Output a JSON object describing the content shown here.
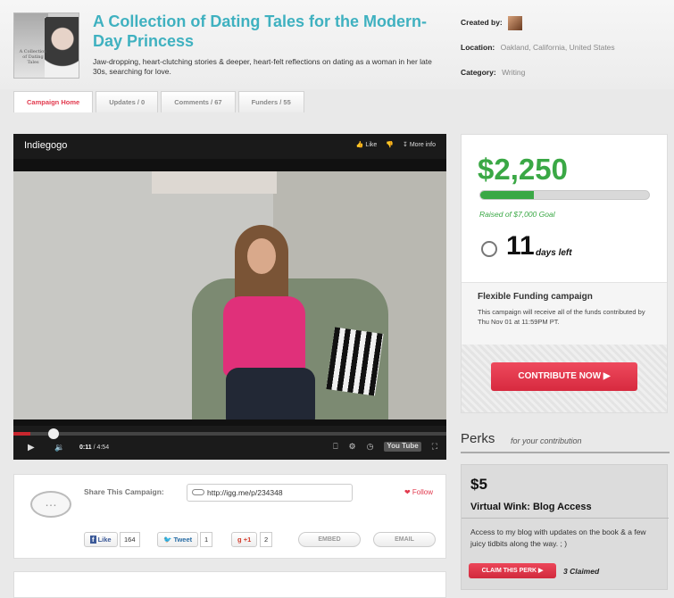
{
  "campaign": {
    "thumbnail_text": "A Collection of Dating Tales",
    "title": "A Collection of Dating Tales for the Modern-Day Princess",
    "subtitle": "Jaw-dropping, heart-clutching stories & deeper, heart-felt reflections on dating as a woman in her late 30s, searching for love."
  },
  "meta": {
    "created_by_label": "Created by:",
    "location_label": "Location:",
    "location_value": "Oakland, California, United States",
    "category_label": "Category:",
    "category_value": "Writing"
  },
  "tabs": [
    {
      "label": "Campaign Home",
      "active": true
    },
    {
      "label": "Updates / 0",
      "active": false
    },
    {
      "label": "Comments / 67",
      "active": false
    },
    {
      "label": "Funders / 55",
      "active": false
    }
  ],
  "video": {
    "brand": "Indiegogo",
    "like_label": "Like",
    "more_info_label": "More info",
    "current_time": "0:11",
    "duration": "/ 4:54",
    "progress_fraction": 0.04,
    "youtube_label": "You Tube"
  },
  "share": {
    "label": "Share This Campaign:",
    "url": "http://igg.me/p/234348",
    "follow_label": "Follow",
    "fb_label": "Like",
    "fb_count": "164",
    "tweet_label": "Tweet",
    "tweet_count": "1",
    "gplus_label": "+1",
    "gplus_count": "2",
    "embed_label": "EMBED",
    "email_label": "EMAIL"
  },
  "funding": {
    "amount": "$2,250",
    "raised_text": "Raised of $7,000 Goal",
    "progress_fraction": 0.32,
    "days_number": "11",
    "days_label": "days left",
    "flex_title": "Flexible Funding campaign",
    "flex_desc": "This campaign will receive all of the funds contributed by Thu Nov 01 at 11:59PM PT.",
    "contribute_label": "CONTRIBUTE NOW ▶"
  },
  "perks": {
    "heading": "Perks",
    "subheading": "for your contribution",
    "items": [
      {
        "amount": "$5",
        "title": "Virtual Wink: Blog Access",
        "desc": "Access to my blog with updates on the book & a few juicy tidbits along the way. ; )",
        "claim_label": "CLAIM THIS PERK ▶",
        "claimed": "3 Claimed"
      }
    ]
  },
  "colors": {
    "accent_red": "#e23a4e",
    "funding_green": "#3aa845",
    "title_teal": "#3fb1c0"
  }
}
